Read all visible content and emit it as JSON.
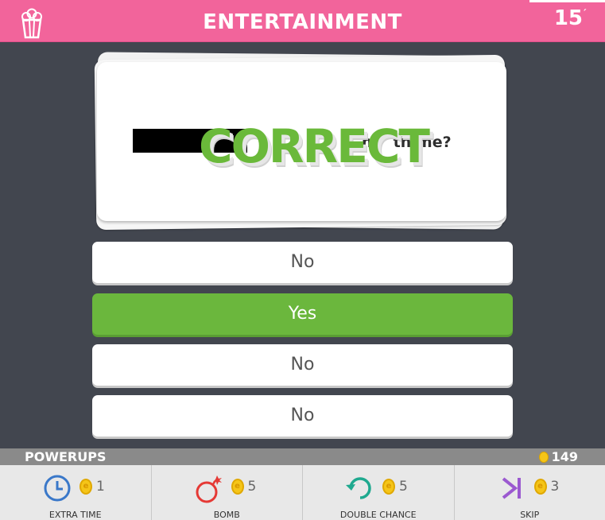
{
  "header": {
    "category": "ENTERTAINMENT",
    "category_icon": "popcorn-icon",
    "timer": "15",
    "timer_suffix": "´",
    "color": "#f2649b"
  },
  "question": {
    "text_visible_tail": "th me?",
    "text_fragment": "m",
    "feedback": "CORRECT",
    "feedback_color": "#6ab93a"
  },
  "answers": [
    {
      "label": "No",
      "state": "default"
    },
    {
      "label": "Yes",
      "state": "correct"
    },
    {
      "label": "No",
      "state": "default"
    },
    {
      "label": "No",
      "state": "default"
    }
  ],
  "powerups": {
    "title": "POWERUPS",
    "coin_balance": "149",
    "items": [
      {
        "name": "EXTRA TIME",
        "cost": "1",
        "icon": "clock-icon",
        "color": "#3a78c9"
      },
      {
        "name": "BOMB",
        "cost": "5",
        "icon": "bomb-icon",
        "color": "#e53935"
      },
      {
        "name": "DOUBLE CHANCE",
        "cost": "5",
        "icon": "double-chance-icon",
        "color": "#1fa98f"
      },
      {
        "name": "SKIP",
        "cost": "3",
        "icon": "skip-icon",
        "color": "#9b59d0"
      }
    ]
  },
  "accent_colors": {
    "correct": "#6bb73d",
    "background": "#42464f",
    "coin": "#f5c518"
  }
}
